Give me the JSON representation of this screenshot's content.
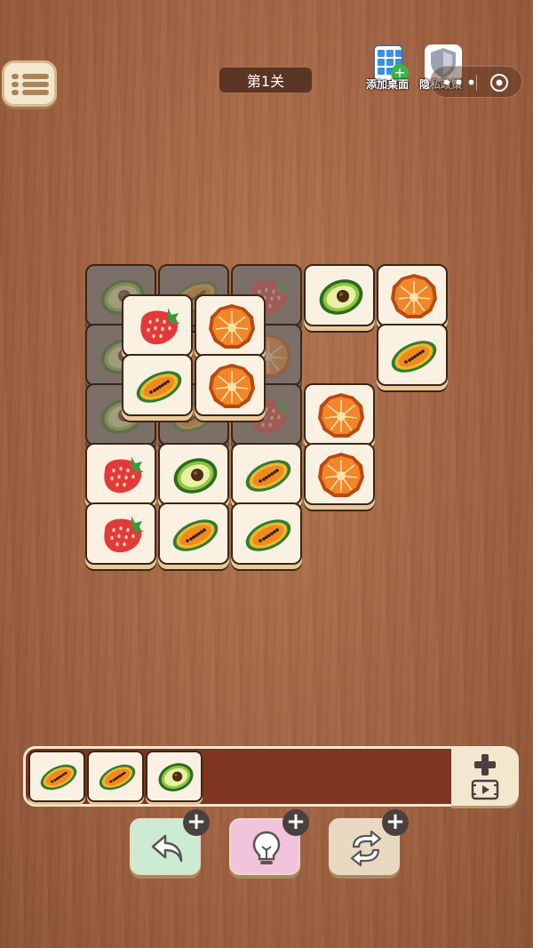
{
  "header": {
    "level_label": "第1关",
    "add_desktop_label": "添加桌面",
    "privacy_label": "隐私政策",
    "capsule_dots": "•••"
  },
  "board": {
    "tiles": [
      {
        "fruit": "avocado",
        "state": "blocked"
      },
      {
        "fruit": "papaya",
        "state": "blocked"
      },
      {
        "fruit": "strawberry",
        "state": "blocked"
      },
      {
        "fruit": "avocado",
        "state": "free"
      },
      {
        "fruit": "orange",
        "state": "free"
      },
      {
        "fruit": "avocado",
        "state": "blocked"
      },
      {
        "fruit": "orange",
        "state": "blocked"
      },
      {
        "fruit": "papaya",
        "state": "free"
      },
      {
        "fruit": "avocado",
        "state": "blocked"
      },
      {
        "fruit": "papaya",
        "state": "blocked"
      },
      {
        "fruit": "strawberry",
        "state": "blocked"
      },
      {
        "fruit": "orange",
        "state": "free"
      },
      {
        "fruit": "strawberry",
        "state": "free"
      },
      {
        "fruit": "orange",
        "state": "free"
      },
      {
        "fruit": "papaya",
        "state": "free"
      },
      {
        "fruit": "orange",
        "state": "free"
      },
      {
        "fruit": "strawberry",
        "state": "free"
      },
      {
        "fruit": "avocado",
        "state": "free"
      },
      {
        "fruit": "papaya",
        "state": "free"
      },
      {
        "fruit": "orange",
        "state": "free"
      },
      {
        "fruit": "strawberry",
        "state": "free"
      },
      {
        "fruit": "papaya",
        "state": "free"
      },
      {
        "fruit": "papaya",
        "state": "free"
      }
    ]
  },
  "tray": {
    "tiles": [
      "papaya",
      "papaya",
      "avocado"
    ]
  },
  "powerups": [
    {
      "name": "undo",
      "icon": "undo-arrow-icon"
    },
    {
      "name": "hint",
      "icon": "lightbulb-icon"
    },
    {
      "name": "shuffle",
      "icon": "shuffle-icon"
    }
  ],
  "colors": {
    "tray_bg": "#7e3521",
    "tile_face": "#fbf1e2",
    "level_bg": "#5a3524",
    "undo_bg": "#cdebd3",
    "hint_bg": "#f2c3dc",
    "shuffle_bg": "#ead9c2"
  }
}
